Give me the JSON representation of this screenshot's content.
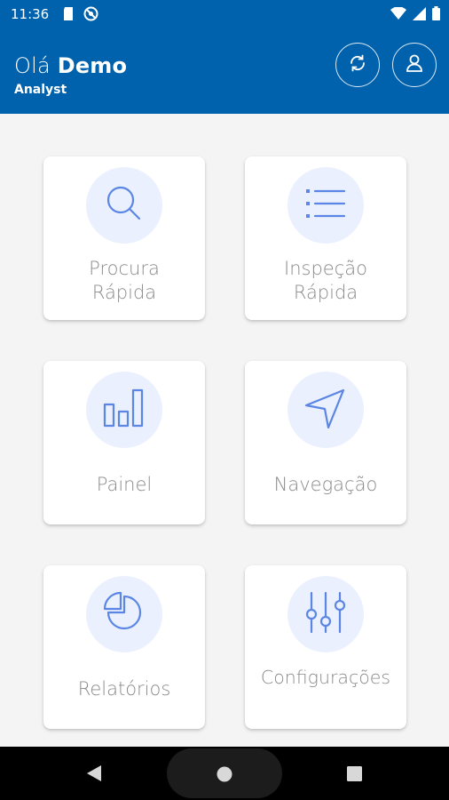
{
  "status_bar": {
    "time": "11:36",
    "icons": [
      "sd-card-icon",
      "no-sync-icon",
      "wifi-icon",
      "signal-icon",
      "battery-icon"
    ]
  },
  "header": {
    "greeting_prefix": "Olá ",
    "user_name": "Demo",
    "role": "Analyst",
    "background_color": "#0062ad"
  },
  "tiles": [
    {
      "label": "Procura\nRápida",
      "icon": "search-icon"
    },
    {
      "label": "Inspeção\nRápida",
      "icon": "list-icon"
    },
    {
      "label": "Painel",
      "icon": "bar-chart-icon"
    },
    {
      "label": "Navegação",
      "icon": "navigation-arrow-icon"
    },
    {
      "label": "Relatórios",
      "icon": "pie-chart-icon"
    },
    {
      "label": "Configurações",
      "icon": "sliders-icon"
    }
  ],
  "colors": {
    "icon_stroke": "#5b86e5",
    "icon_circle": "#eaf0fd",
    "label_text": "#8a8a8a"
  },
  "nav_bar": {
    "buttons": [
      "back-icon",
      "home-icon",
      "recents-icon"
    ]
  }
}
